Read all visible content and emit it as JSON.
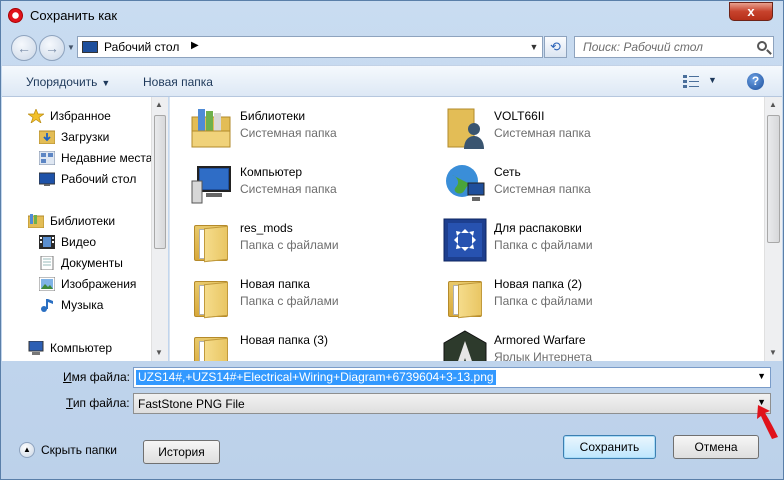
{
  "window": {
    "title": "Сохранить как",
    "close_glyph": "x"
  },
  "nav": {
    "back_glyph": "←",
    "forward_glyph": "→",
    "recent_glyph": "▼",
    "address_crumb": "Рабочий стол",
    "crumb_arrow": "▶",
    "address_dropdown": "▼",
    "refresh_glyph": "⟲",
    "search_placeholder": "Поиск: Рабочий стол"
  },
  "toolbar": {
    "organize": "Упорядочить",
    "organize_arrow": "▼",
    "new_folder": "Новая папка",
    "view_arrow": "▼",
    "help": "?"
  },
  "navpane": {
    "items": [
      {
        "label": "Избранное",
        "icon": "star-icon"
      },
      {
        "label": "Загрузки",
        "icon": "downloads-folder-icon"
      },
      {
        "label": "Недавние места",
        "icon": "recent-places-icon"
      },
      {
        "label": "Рабочий стол",
        "icon": "desktop-icon"
      },
      {
        "label": "Библиотеки",
        "icon": "libraries-icon"
      },
      {
        "label": "Видео",
        "icon": "video-icon"
      },
      {
        "label": "Документы",
        "icon": "documents-icon"
      },
      {
        "label": "Изображения",
        "icon": "pictures-icon"
      },
      {
        "label": "Музыка",
        "icon": "music-icon"
      },
      {
        "label": "Компьютер",
        "icon": "computer-icon"
      }
    ],
    "scroll_up": "▲",
    "scroll_down": "▼"
  },
  "files": {
    "items": [
      {
        "name": "Библиотеки",
        "type": "Системная папка",
        "icon": "libraries-icon"
      },
      {
        "name": "VOLT66II",
        "type": "Системная папка",
        "icon": "user-folder-icon"
      },
      {
        "name": "Компьютер",
        "type": "Системная папка",
        "icon": "computer-icon"
      },
      {
        "name": "Сеть",
        "type": "Системная папка",
        "icon": "network-icon"
      },
      {
        "name": "res_mods",
        "type": "Папка с файлами",
        "icon": "folder-icon"
      },
      {
        "name": "Для распаковки",
        "type": "Папка с файлами",
        "icon": "unpack-folder-icon"
      },
      {
        "name": "Новая папка",
        "type": "Папка с файлами",
        "icon": "folder-icon"
      },
      {
        "name": "Новая папка (2)",
        "type": "Папка с файлами",
        "icon": "folder-icon"
      },
      {
        "name": "Новая папка (3)",
        "type": "",
        "icon": "folder-icon"
      },
      {
        "name": "Armored Warfare",
        "type": "Ярлык Интернета",
        "icon": "armored-warfare-icon"
      }
    ],
    "scroll_up": "▲",
    "scroll_down": "▼"
  },
  "form": {
    "filename_label_u": "И",
    "filename_label_rest": "мя файла:",
    "filename_value": "UZS14#,+UZS14#+Electrical+Wiring+Diagram+6739604+3-13.png",
    "filename_dropdown": "▼",
    "filetype_label_u": "Т",
    "filetype_label_rest": "ип файла:",
    "filetype_value": "FastStone PNG File",
    "filetype_dropdown": "▼"
  },
  "footer": {
    "hide_folders": "Скрыть папки",
    "hide_folders_glyph": "▲",
    "history": "История",
    "save": "Сохранить",
    "cancel": "Отмена"
  },
  "colors": {
    "accent": "#3399ff",
    "annotation": "#e0121b",
    "titlebar": "#c9dcf1"
  }
}
